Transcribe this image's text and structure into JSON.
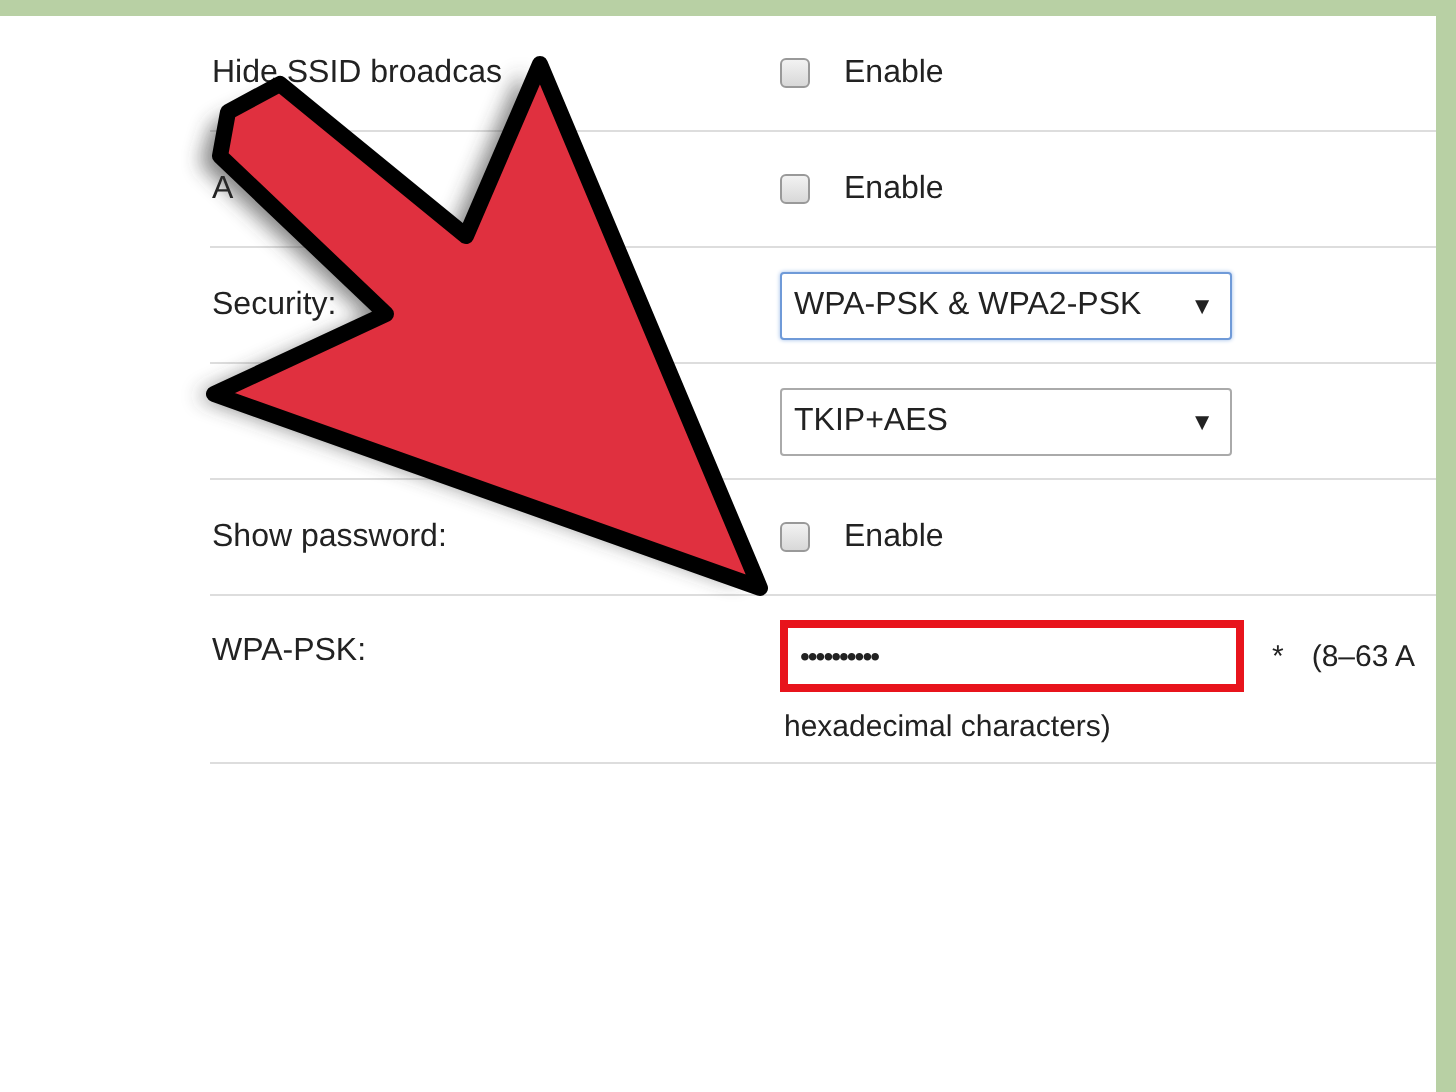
{
  "settings": {
    "rows": [
      {
        "kind": "checkbox",
        "label": "Hide SSID broadcas",
        "checked": false,
        "option": "Enable"
      },
      {
        "kind": "checkbox",
        "label": "A",
        "checked": false,
        "option": "Enable"
      },
      {
        "kind": "select",
        "label": "Security:",
        "value": "WPA-PSK & WPA2-PSK",
        "caret": "▼",
        "focused": true
      },
      {
        "kind": "select",
        "value": "TKIP+AES",
        "caret": "▼",
        "focused": false
      },
      {
        "kind": "checkbox",
        "label": "Show password:",
        "checked": false,
        "option": "Enable"
      },
      {
        "kind": "password",
        "label": "WPA-PSK:",
        "value": "••••••••••",
        "highlighted": true,
        "required": "*",
        "hint": "(8–63 A",
        "hint_more": "hexadecimal characters)"
      }
    ]
  }
}
